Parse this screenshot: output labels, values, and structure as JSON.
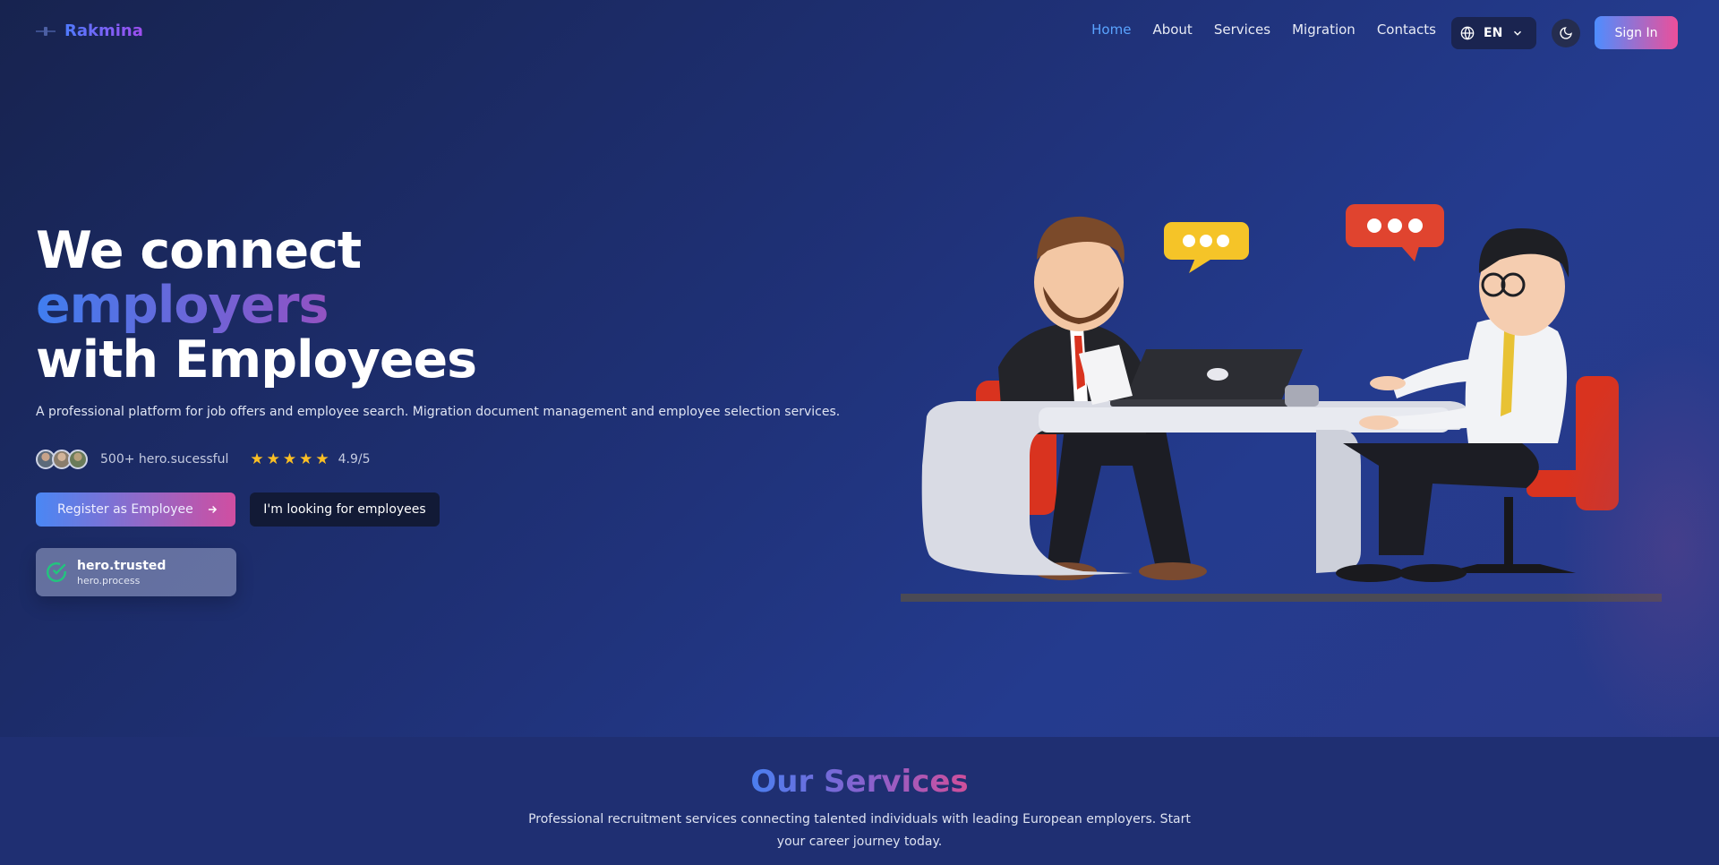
{
  "nav": {
    "logo": "Rakmina",
    "items": [
      {
        "label": "Home",
        "active": true
      },
      {
        "label": "About",
        "active": false
      },
      {
        "label": "Services",
        "active": false
      },
      {
        "label": "Migration",
        "active": false
      },
      {
        "label": "Contacts",
        "active": false
      }
    ],
    "language": "EN",
    "signin": "Sign In"
  },
  "hero": {
    "line1": "We connect",
    "line2": "employers",
    "line3": "with Employees",
    "subtitle": "A professional platform for job offers and employee search. Migration document management and employee selection services.",
    "success_text": "500+ hero.sucessful",
    "rating": 5,
    "rating_text": "4.9/5",
    "primary_button": "Register as Employee",
    "secondary_button": "I'm looking for employees",
    "trusted_title": "hero.trusted",
    "trusted_sub": "hero.process"
  },
  "services": {
    "title": "Our Services",
    "description": "Professional recruitment services connecting talented individuals with leading European employers. Start your career journey today."
  },
  "colors": {
    "accent_blue": "#4e8dff",
    "accent_pink": "#ec4f9a",
    "active_link": "#5aa4ff",
    "star": "#fbbf24"
  }
}
